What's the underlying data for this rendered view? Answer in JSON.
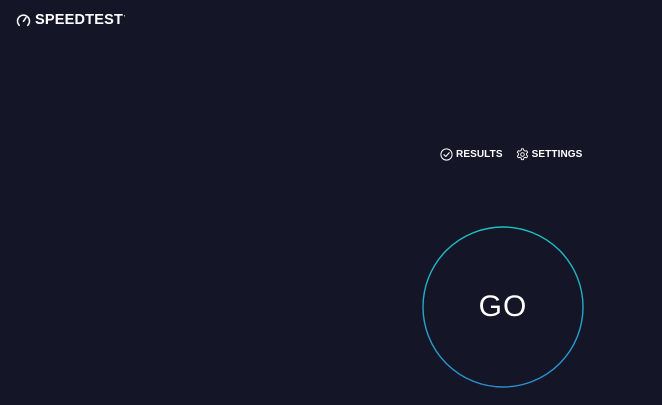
{
  "header": {
    "logo_text": "SPEEDTEST",
    "logo_mark": "'",
    "logo_icon": "gauge-icon"
  },
  "nav": {
    "results": {
      "label": "RESULTS",
      "icon": "checkmark-circle-icon"
    },
    "settings": {
      "label": "SETTINGS",
      "icon": "gear-icon"
    }
  },
  "go_button": {
    "label": "GO"
  },
  "colors": {
    "background": "#141526",
    "text": "#ffffff",
    "ring_start": "#1bc2c2",
    "ring_end": "#2a8fd0"
  }
}
